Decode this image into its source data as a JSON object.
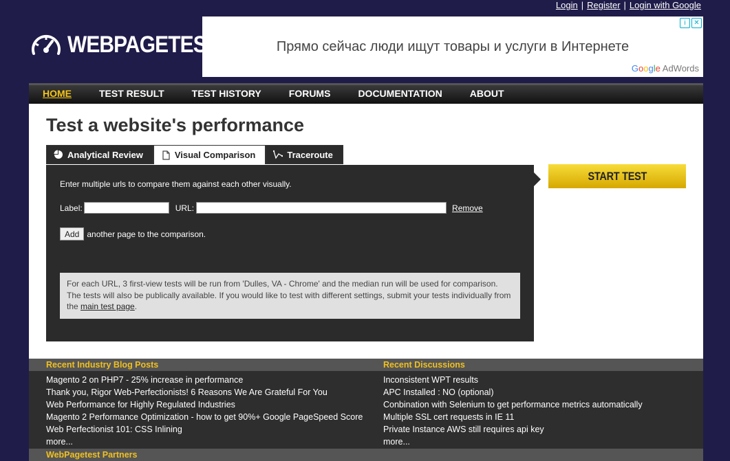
{
  "auth": {
    "login": "Login",
    "register": "Register",
    "login_google": "Login with Google",
    "sep": "|"
  },
  "logo": {
    "part1": "WEB",
    "part2": "PAGETEST"
  },
  "ad": {
    "text": "Прямо сейчас люди ищут товары и услуги в Интернете",
    "brand_suffix": " AdWords",
    "info_icon": "i",
    "close_icon": "✕"
  },
  "nav": {
    "items": [
      "HOME",
      "TEST RESULT",
      "TEST HISTORY",
      "FORUMS",
      "DOCUMENTATION",
      "ABOUT"
    ]
  },
  "page_title": "Test a website's performance",
  "tabs": [
    {
      "label": "Analytical Review",
      "icon": "pie-chart-icon"
    },
    {
      "label": "Visual Comparison",
      "icon": "document-icon"
    },
    {
      "label": "Traceroute",
      "icon": "traceroute-icon"
    }
  ],
  "panel": {
    "intro": "Enter multiple urls to compare them against each other visually.",
    "label_label": "Label:",
    "url_label": "URL:",
    "remove": "Remove",
    "add_button": "Add",
    "add_suffix": "another page to the comparison.",
    "note_prefix": "For each URL, 3 first-view tests will be run from 'Dulles, VA - Chrome' and the median run will be used for comparison. The tests will also be publically available. If you would like to test with different settings, submit your tests individually from the ",
    "note_link": "main test page",
    "note_suffix": "."
  },
  "start_test": "START TEST",
  "blog": {
    "heading": "Recent Industry Blog Posts",
    "items": [
      "Magento 2 on PHP7 - 25% increase in performance",
      "Thank you, Rigor Web-Perfectionists! 6 Reasons We Are Grateful For You",
      "Web Performance for Highly Regulated Industries",
      "Magento 2 Performance Optimization - how to get 90%+ Google PageSpeed Score",
      "Web Perfectionist 101: CSS Inlining",
      "more..."
    ]
  },
  "discussions": {
    "heading": "Recent Discussions",
    "items": [
      "Inconsistent WPT results",
      "APC Installed : NO (optional)",
      "Conbination with Selenium to get performance metrics automatically",
      "Multiple SSL cert requests in IE 11",
      "Private Instance AWS still requires api key",
      "more..."
    ]
  },
  "partners": {
    "heading": "WebPagetest Partners"
  },
  "colors": {
    "background": "#1f1c4a",
    "accent": "#f5c518",
    "panel": "#2b2b2b"
  }
}
